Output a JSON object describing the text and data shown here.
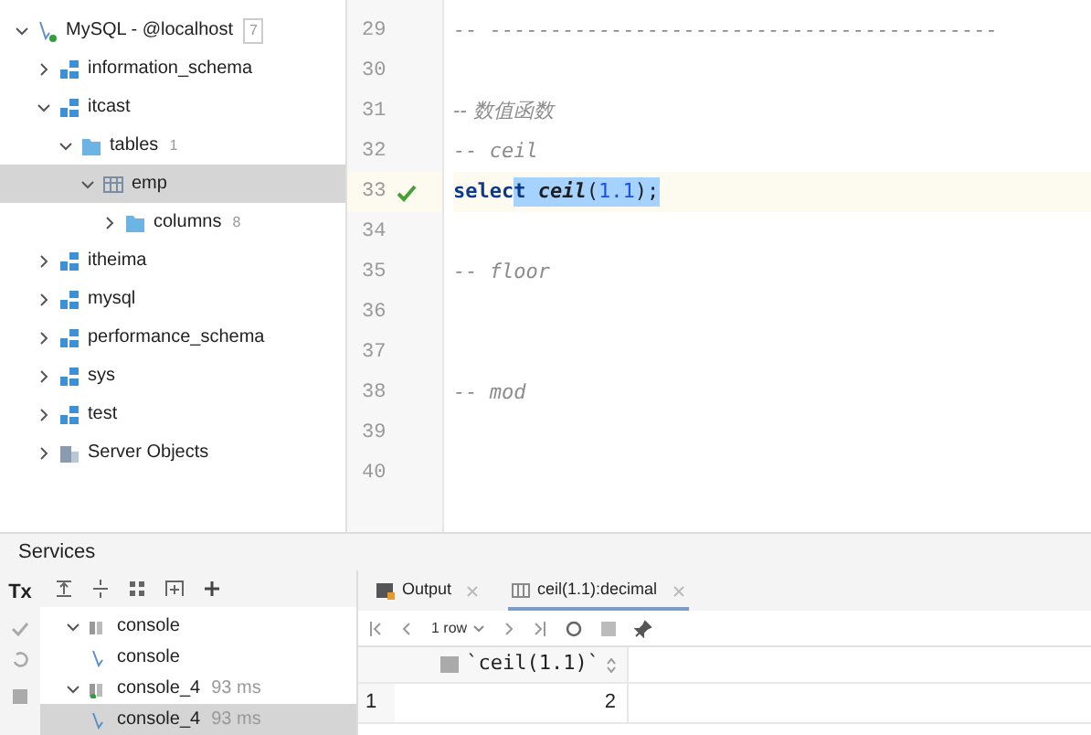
{
  "db_tree": [
    {
      "label": "MySQL - @localhost",
      "kind": "server",
      "expanded": true,
      "badge": "7",
      "selected": false,
      "children": [
        {
          "label": "information_schema",
          "kind": "schema",
          "expanded": false,
          "selected": false
        },
        {
          "label": "itcast",
          "kind": "schema",
          "expanded": true,
          "selected": false,
          "children": [
            {
              "label": "tables",
              "kind": "folder",
              "expanded": true,
              "badge": "1",
              "selected": false,
              "children": [
                {
                  "label": "emp",
                  "kind": "table",
                  "expanded": true,
                  "selected": true,
                  "children": [
                    {
                      "label": "columns",
                      "kind": "folder",
                      "expanded": false,
                      "badge": "8",
                      "selected": false
                    }
                  ]
                }
              ]
            }
          ]
        },
        {
          "label": "itheima",
          "kind": "schema",
          "expanded": false,
          "selected": false
        },
        {
          "label": "mysql",
          "kind": "schema",
          "expanded": false,
          "selected": false
        },
        {
          "label": "performance_schema",
          "kind": "schema",
          "expanded": false,
          "selected": false
        },
        {
          "label": "sys",
          "kind": "schema",
          "expanded": false,
          "selected": false
        },
        {
          "label": "test",
          "kind": "schema",
          "expanded": false,
          "selected": false
        },
        {
          "label": "Server Objects",
          "kind": "objects",
          "expanded": false,
          "selected": false
        }
      ]
    }
  ],
  "editor": {
    "lines": [
      {
        "number": "29",
        "tokens": [
          {
            "text": "-- ------------------------------------------",
            "kind": "comment",
            "selected": false
          }
        ]
      },
      {
        "number": "30"
      },
      {
        "number": "31",
        "tokens": [
          {
            "text": "-- 数值函数",
            "kind": "comment",
            "selected": false
          }
        ]
      },
      {
        "number": "32",
        "tokens": [
          {
            "text": "-- ceil",
            "kind": "comment",
            "selected": false
          }
        ]
      },
      {
        "number": "33",
        "current": true,
        "ok": true,
        "tokens": [
          {
            "text": "selec",
            "kind": "keyword",
            "selected": false
          },
          {
            "text": "t ",
            "kind": "keyword",
            "selected": true
          },
          {
            "text": "ceil",
            "kind": "function",
            "selected": true
          },
          {
            "text": "(",
            "kind": "plain",
            "selected": true
          },
          {
            "text": "1.1",
            "kind": "number",
            "selected": true
          },
          {
            "text": ");",
            "kind": "plain",
            "selected": true
          }
        ]
      },
      {
        "number": "34"
      },
      {
        "number": "35",
        "tokens": [
          {
            "text": "-- floor",
            "kind": "comment",
            "selected": false
          }
        ]
      },
      {
        "number": "36"
      },
      {
        "number": "37"
      },
      {
        "number": "38",
        "tokens": [
          {
            "text": "-- mod",
            "kind": "comment",
            "selected": false
          }
        ]
      },
      {
        "number": "39"
      },
      {
        "number": "40"
      }
    ]
  },
  "services": {
    "title": "Services",
    "tx_label": "Tx",
    "tree": [
      {
        "label": "console",
        "kind": "console-group",
        "expanded": true,
        "selected": false,
        "children": [
          {
            "label": "console",
            "kind": "console",
            "selected": false
          }
        ]
      },
      {
        "label": "console_4",
        "kind": "console-group",
        "expanded": true,
        "time": "93 ms",
        "selected": false,
        "children": [
          {
            "label": "console_4",
            "kind": "console",
            "time": "93 ms",
            "selected": true
          }
        ]
      }
    ]
  },
  "results": {
    "tabs": [
      {
        "label": "Output",
        "kind": "output",
        "selected": false
      },
      {
        "label": "ceil(1.1):decimal",
        "kind": "table",
        "selected": true
      }
    ],
    "row_count": "1 row",
    "columns": [
      "`ceil(1.1)`"
    ],
    "rows": [
      {
        "number": "1",
        "cells": [
          "2"
        ]
      }
    ]
  }
}
